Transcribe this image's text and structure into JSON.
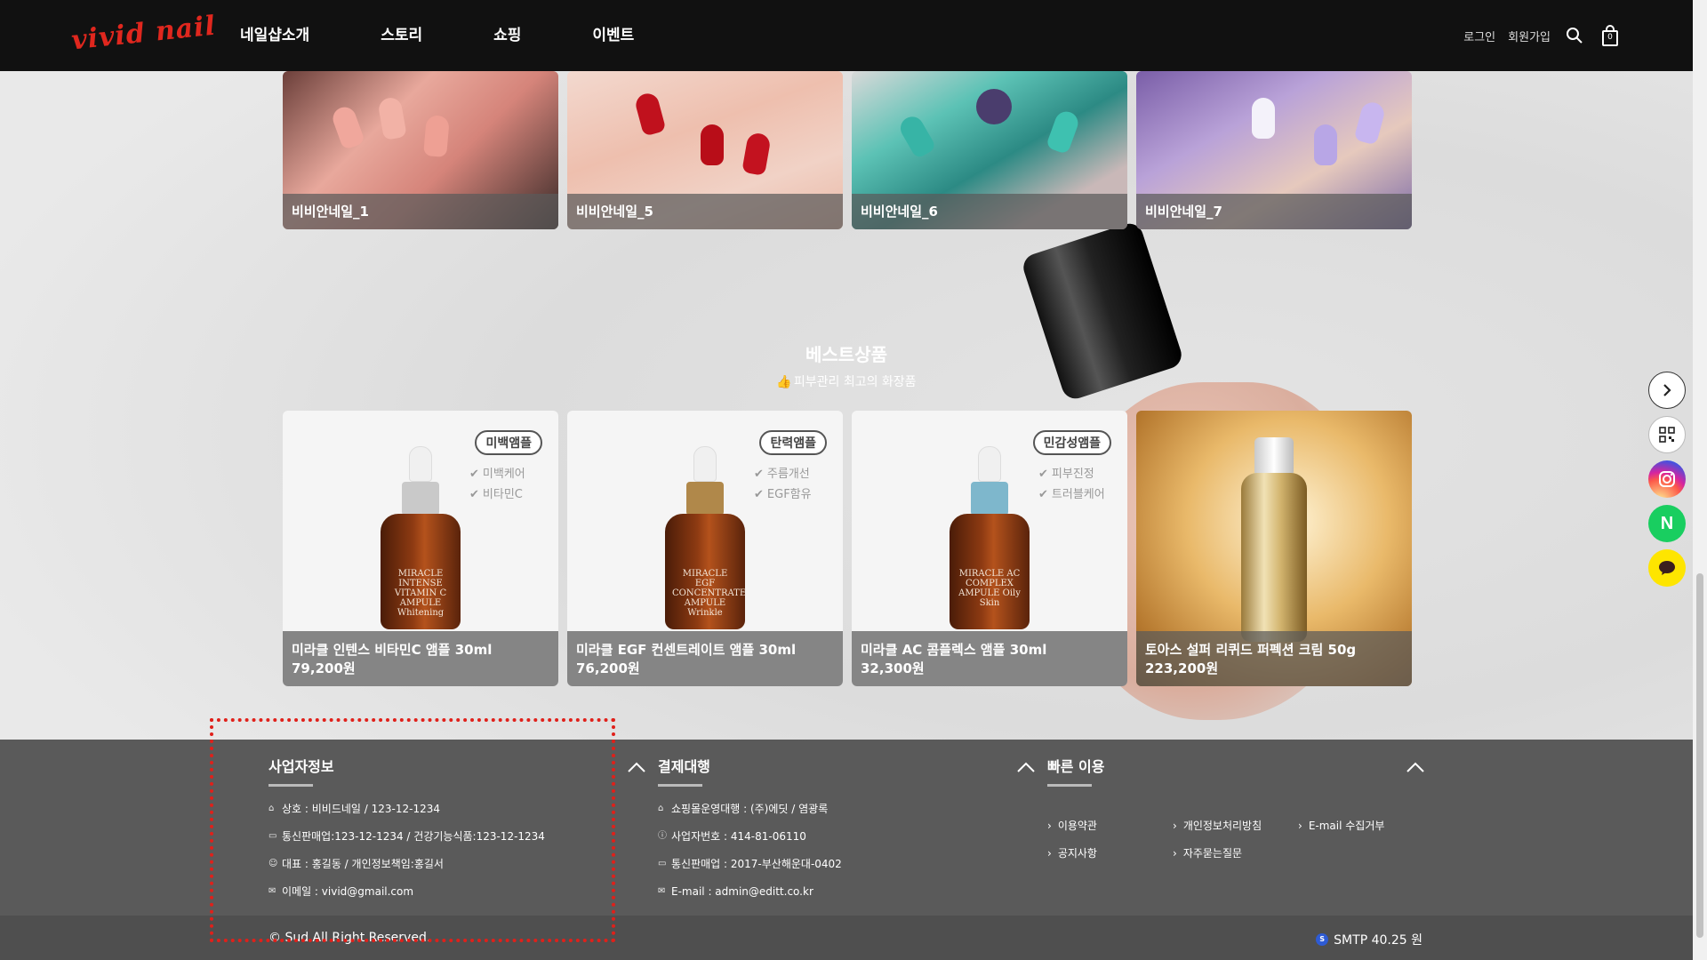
{
  "header": {
    "logo": "vivid nail",
    "nav": [
      "네일샵소개",
      "스토리",
      "쇼핑",
      "이벤트"
    ],
    "login": "로그인",
    "signup": "회원가입",
    "cart_count": "0"
  },
  "gallery": [
    {
      "caption": "비비안네일_1"
    },
    {
      "caption": "비비안네일_5"
    },
    {
      "caption": "비비안네일_6"
    },
    {
      "caption": "비비안네일_7"
    }
  ],
  "best": {
    "title": "베스트상품",
    "subtitle": "피부관리 최고의 화장품",
    "products": [
      {
        "name": "미라클 인텐스 비타민C 앰플 30ml",
        "price": "79,200원",
        "badge": "미백앰플",
        "features": [
          "미백케어",
          "비타민C"
        ],
        "bottle_label": "MIRACLE INTENSE VITAMIN C AMPULE Whitening",
        "neck_color": "#c9c9c9"
      },
      {
        "name": "미라클 EGF 컨센트레이트 앰플 30ml",
        "price": "76,200원",
        "badge": "탄력앰플",
        "features": [
          "주름개선",
          "EGF함유"
        ],
        "bottle_label": "MIRACLE EGF CONCENTRATE AMPULE Wrinkle",
        "neck_color": "#b0884a"
      },
      {
        "name": "미라클 AC 콤플렉스 앰플 30ml",
        "price": "32,300원",
        "badge": "민감성앰플",
        "features": [
          "피부진정",
          "트러블케어"
        ],
        "bottle_label": "MIRACLE AC COMPLEX AMPULE Oily Skin",
        "neck_color": "#7eb7cc"
      },
      {
        "name": "토아스 설퍼 리퀴드 퍼펙션 크림 50g",
        "price": "223,200원"
      }
    ]
  },
  "footer": {
    "business": {
      "title": "사업자정보",
      "lines": [
        {
          "icon": "home-icon",
          "text": "상호 : 비비드네일 / 123-12-1234"
        },
        {
          "icon": "id-card-icon",
          "text": "통신판매업:123-12-1234 / 건강기능식품:123-12-1234"
        },
        {
          "icon": "user-icon",
          "text": "대표 : 홍길동 / 개인정보책임:홍길서"
        },
        {
          "icon": "mail-icon",
          "text": "이메일 : vivid@gmail.com"
        }
      ]
    },
    "payment": {
      "title": "결제대행",
      "lines": [
        {
          "icon": "home-icon",
          "text": "쇼핑몰운영대행 : (주)에딧 / 염광록"
        },
        {
          "icon": "info-icon",
          "text": "사업자번호 : 414-81-06110"
        },
        {
          "icon": "id-card-icon",
          "text": "통신판매업 : 2017-부산해운대-0402"
        },
        {
          "icon": "mail-icon",
          "text": "E-mail : admin@editt.co.kr"
        }
      ]
    },
    "quick": {
      "title": "빠른 이용",
      "links": [
        "이용약관",
        "개인정보처리방침",
        "E-mail 수집거부",
        "공지사항",
        "자주묻는질문"
      ]
    },
    "copyright": "© Sud All Right Reserved.",
    "smtp": "SMTP 40.25 원"
  },
  "colors": {
    "header_bg": "#111111",
    "footer_bg": "#5a5a5a",
    "highlight": "#e0201a"
  }
}
